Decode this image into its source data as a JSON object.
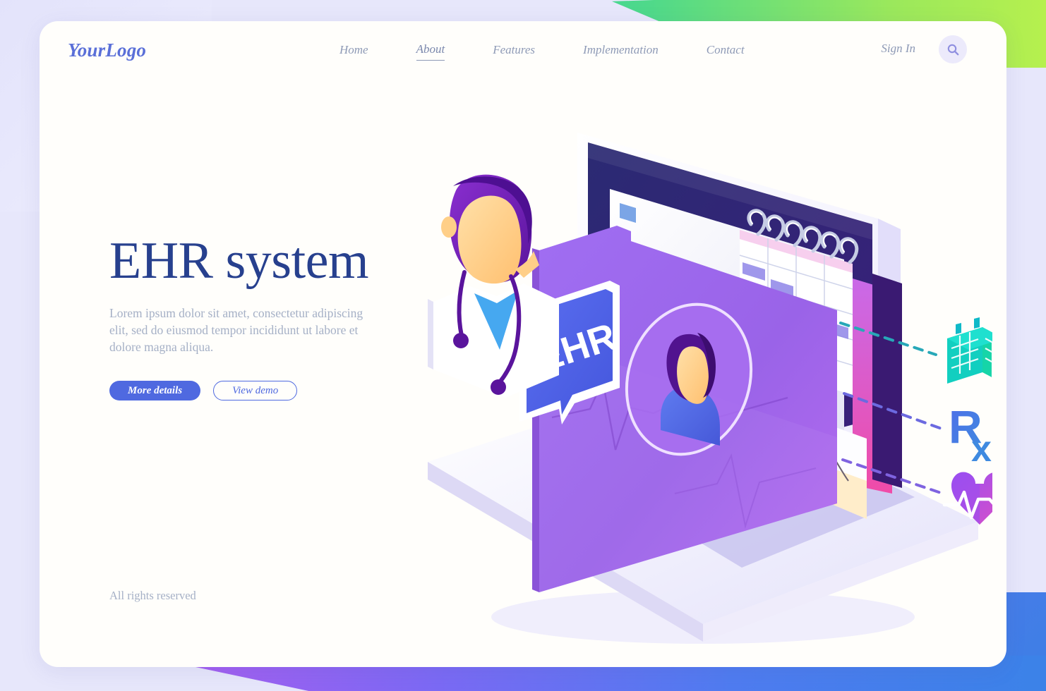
{
  "brand": {
    "logo": "YourLogo",
    "accent": "#4f69e0",
    "heading_color": "#27408e",
    "muted_color": "#a5b0c6"
  },
  "nav": {
    "items": [
      {
        "label": "Home",
        "active": false
      },
      {
        "label": "About",
        "active": true
      },
      {
        "label": "Features",
        "active": false
      },
      {
        "label": "Implementation",
        "active": false
      },
      {
        "label": "Contact",
        "active": false
      }
    ],
    "signin_label": "Sign In",
    "search_icon": "search-icon"
  },
  "hero": {
    "title": "EHR system",
    "paragraph": "Lorem ipsum dolor sit amet, consectetur adipiscing elit, sed do eiusmod tempor incididunt ut labore et dolore magna aliqua.",
    "primary_button": "More details",
    "secondary_button": "View demo"
  },
  "footer": {
    "rights": "All rights reserved"
  },
  "illustration": {
    "speech_bubble_label": "EHR",
    "speech_bubble_color": "#4f69e0",
    "laptop_screen_color": "#2b2a73",
    "folder_color": "#9a63e8",
    "feature_icons": [
      {
        "name": "calendar-icon",
        "color": "#12cfc0"
      },
      {
        "name": "prescription-icon",
        "color": "#3f6fe0"
      },
      {
        "name": "heart-pulse-icon",
        "color": "#b14fe0"
      }
    ],
    "doctor": {
      "hair_color": "#6b20b5",
      "skin_color": "#ffcf88",
      "coat_color": "#ffffff",
      "scrubs_color": "#46a8f0",
      "stethoscope_color": "#6b20b5"
    },
    "patient_avatar": {
      "hair_color": "#51138f",
      "skin_color": "#ffcf88",
      "shirt_color": "#4f69e0"
    }
  },
  "background": {
    "page_color": "#e7e7fb",
    "card_color": "#fffefb",
    "top_band_gradient": [
      "#00b8d4",
      "#b6f04e"
    ],
    "bottom_band_gradient": [
      "#c850e8",
      "#3b82e8"
    ]
  }
}
